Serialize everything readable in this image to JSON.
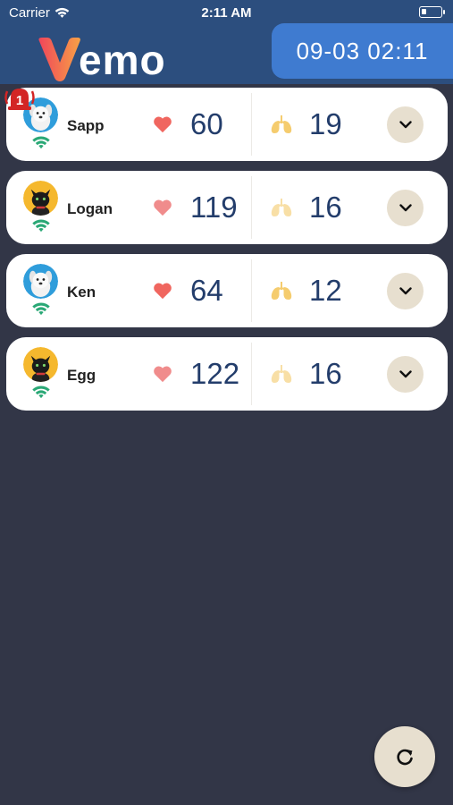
{
  "status_bar": {
    "carrier": "Carrier",
    "time": "2:11 AM"
  },
  "header": {
    "logo_text": "emo",
    "datetime": "09-03 02:11",
    "colors": {
      "header_bg": "#2c4e7e",
      "date_bg": "#3f7bd0",
      "logo_v_start": "#f0465a",
      "logo_v_end": "#f7a146"
    }
  },
  "pets": [
    {
      "name": "Sapp",
      "heart_rate": "60",
      "resp_rate": "19",
      "avatar": "dog-avatar",
      "alarm_count": "1",
      "heart_color": "#f0665f",
      "lung_color": "#f5cc6e"
    },
    {
      "name": "Logan",
      "heart_rate": "119",
      "resp_rate": "16",
      "avatar": "cat-avatar",
      "alarm_count": "",
      "heart_color": "#f08c8c",
      "lung_color": "#f8dfa6"
    },
    {
      "name": "Ken",
      "heart_rate": "64",
      "resp_rate": "12",
      "avatar": "dog-avatar",
      "alarm_count": "",
      "heart_color": "#f0665f",
      "lung_color": "#f5cc6e"
    },
    {
      "name": "Egg",
      "heart_rate": "122",
      "resp_rate": "16",
      "avatar": "cat-avatar",
      "alarm_count": "",
      "heart_color": "#f08c8c",
      "lung_color": "#f8dfa6"
    }
  ],
  "icons": {
    "refresh": "refresh-icon",
    "expand": "chevron-down-icon",
    "wifi": "wifi-icon",
    "heart": "heart-icon",
    "lungs": "lungs-icon",
    "alarm": "alarm-bell-icon"
  },
  "colors": {
    "background": "#323647",
    "card": "#ffffff",
    "value_text": "#233d6b",
    "button_bg": "#e7dfcf",
    "wifi": "#2aa876",
    "alarm": "#d32525"
  }
}
